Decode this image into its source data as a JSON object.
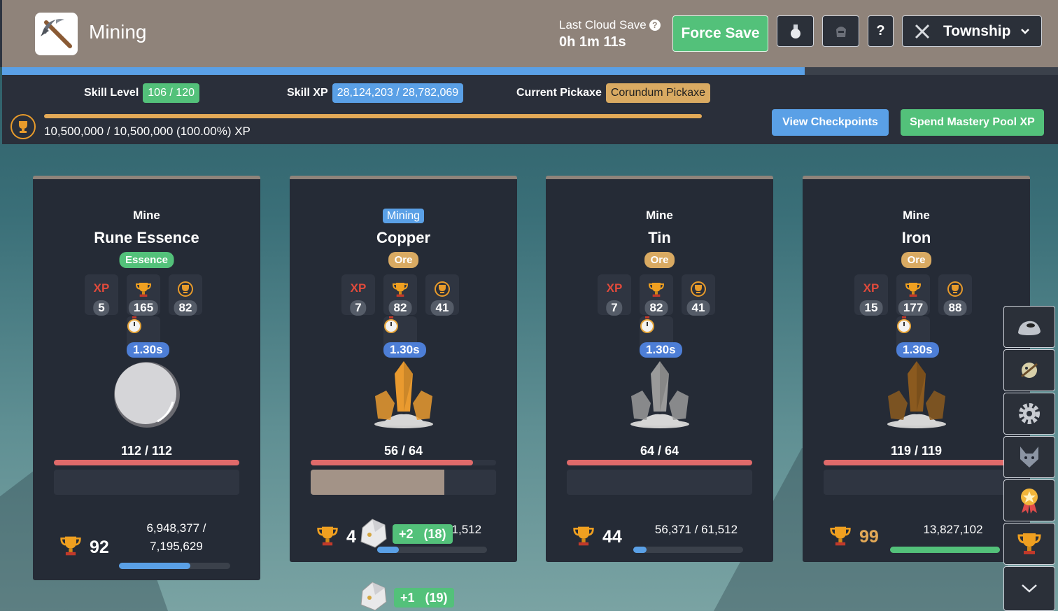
{
  "header": {
    "title": "Mining",
    "cloud_save_label": "Last Cloud Save",
    "cloud_help": "?",
    "cloud_save_time": "0h 1m 11s",
    "force_save": "Force Save",
    "help_label": "?",
    "township_label": "Township",
    "icons": [
      "pickaxe-icon",
      "potion-icon",
      "equipment-icon",
      "help-icon",
      "township-icon",
      "chevron-down-icon"
    ]
  },
  "skill": {
    "level_label": "Skill Level",
    "level_value": "106 / 120",
    "xp_label": "Skill XP",
    "xp_value": "28,124,203 / 28,782,069",
    "pickaxe_label": "Current Pickaxe",
    "pickaxe_value": "Corundum Pickaxe",
    "level_progress": 0.76,
    "mastery_pool_text": "10,500,000 / 10,500,000 (100.00%) XP",
    "mastery_pool_progress": 1.0,
    "view_checkpoints": "View Checkpoints",
    "spend_mastery": "Spend Mastery Pool XP"
  },
  "rocks": [
    {
      "verb": "Mine",
      "name": "Rune Essence",
      "type": "Essence",
      "xp": "5",
      "mastery_xp": "165",
      "pool_xp": "82",
      "time": "1.30s",
      "hp": "112 / 112",
      "hp_progress": 1.0,
      "mine_progress": 0.0,
      "mastery_level": "92",
      "mastery_xp_text": "6,948,377 / 7,195,629",
      "mastery_progress": 0.64,
      "color": "#d5d5d8"
    },
    {
      "verb": "Mining",
      "name": "Copper",
      "type": "Ore",
      "xp": "7",
      "mastery_xp": "82",
      "pool_xp": "41",
      "time": "1.30s",
      "hp": "56 / 64",
      "hp_progress": 0.875,
      "mine_progress": 0.72,
      "mastery_level": "4",
      "mastery_xp_text": "59,927 / 61,512",
      "mastery_progress": 0.2,
      "color": "#e99a2f"
    },
    {
      "verb": "Mine",
      "name": "Tin",
      "type": "Ore",
      "xp": "7",
      "mastery_xp": "82",
      "pool_xp": "41",
      "time": "1.30s",
      "hp": "64 / 64",
      "hp_progress": 1.0,
      "mine_progress": 0.0,
      "mastery_level": "44",
      "mastery_xp_text": "56,371 / 61,512",
      "mastery_progress": 0.12,
      "color": "#9a9a9a"
    },
    {
      "verb": "Mine",
      "name": "Iron",
      "type": "Ore",
      "xp": "15",
      "mastery_xp": "177",
      "pool_xp": "88",
      "time": "1.30s",
      "hp": "119 / 119",
      "hp_progress": 1.0,
      "mine_progress": 0.0,
      "mastery_level": "99",
      "mastery_xp_text": "13,827,102",
      "mastery_progress": 1.0,
      "color": "#8b5a1f"
    }
  ],
  "loot": [
    {
      "text": "+2   (18)"
    },
    {
      "text": "+1   (19)"
    }
  ],
  "side_menu": [
    "rock-icon",
    "golbin-icon",
    "settings-gear-icon",
    "wolf-icon",
    "medal-icon",
    "trophy-icon",
    "chevron-down-icon"
  ]
}
